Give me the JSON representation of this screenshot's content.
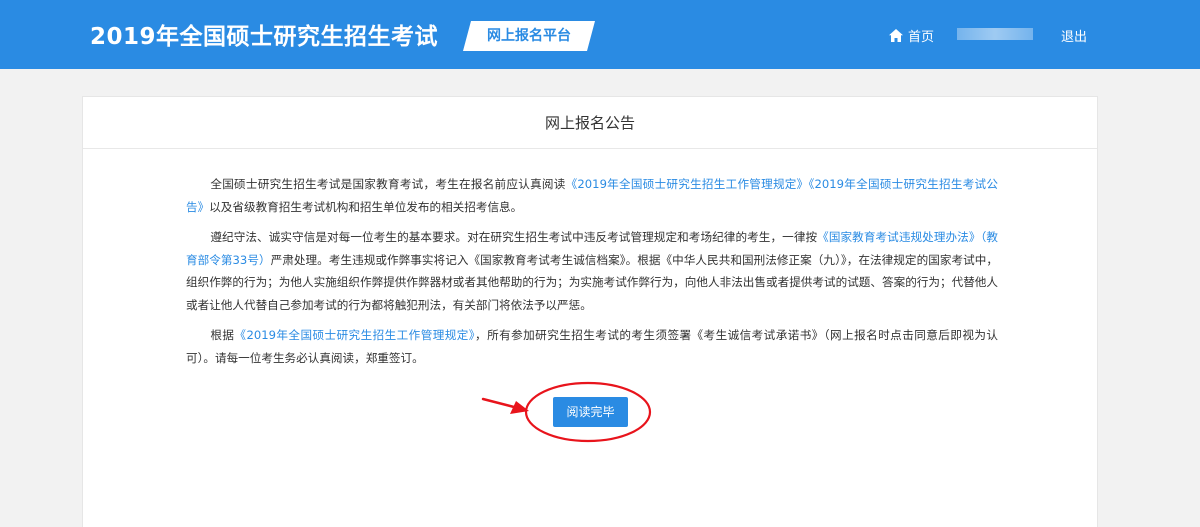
{
  "header": {
    "title": "2019年全国硕士研究生招生考试",
    "platform_badge": "网上报名平台",
    "home_icon": "home-icon",
    "home_label": "首页",
    "logout_label": "退出"
  },
  "notice": {
    "title": "网上报名公告",
    "p1": {
      "t1": "全国硕士研究生招生考试是国家教育考试，考生在报名前应认真阅读",
      "link1": "《2019年全国硕士研究生招生工作管理规定》",
      "link2": "《2019年全国硕士研究生招生考试公告》",
      "t2": "以及省级教育招生考试机构和招生单位发布的相关招考信息。"
    },
    "p2": {
      "t1": "遵纪守法、诚实守信是对每一位考生的基本要求。对在研究生招生考试中违反考试管理规定和考场纪律的考生，一律按",
      "link1": "《国家教育考试违规处理办法》（教育部令第33号）",
      "t2": "严肃处理。考生违规或作弊事实将记入《国家教育考试考生诚信档案》。根据《中华人民共和国刑法修正案（九）》，在法律规定的国家考试中，组织作弊的行为；为他人实施组织作弊提供作弊器材或者其他帮助的行为；为实施考试作弊行为，向他人非法出售或者提供考试的试题、答案的行为；代替他人或者让他人代替自己参加考试的行为都将触犯刑法，有关部门将依法予以严惩。"
    },
    "p3": {
      "t1": "根据",
      "link1": "《2019年全国硕士研究生招生工作管理规定》",
      "t2": "，所有参加研究生招生考试的考生须签署《考生诚信考试承诺书》（网上报名时点击同意后即视为认可）。请每一位考生务必认真阅读，郑重签订。"
    },
    "read_button": "阅读完毕"
  },
  "colors": {
    "header_bg": "#2a8be3",
    "link": "#2a8be3",
    "annotation": "#e8141c"
  }
}
